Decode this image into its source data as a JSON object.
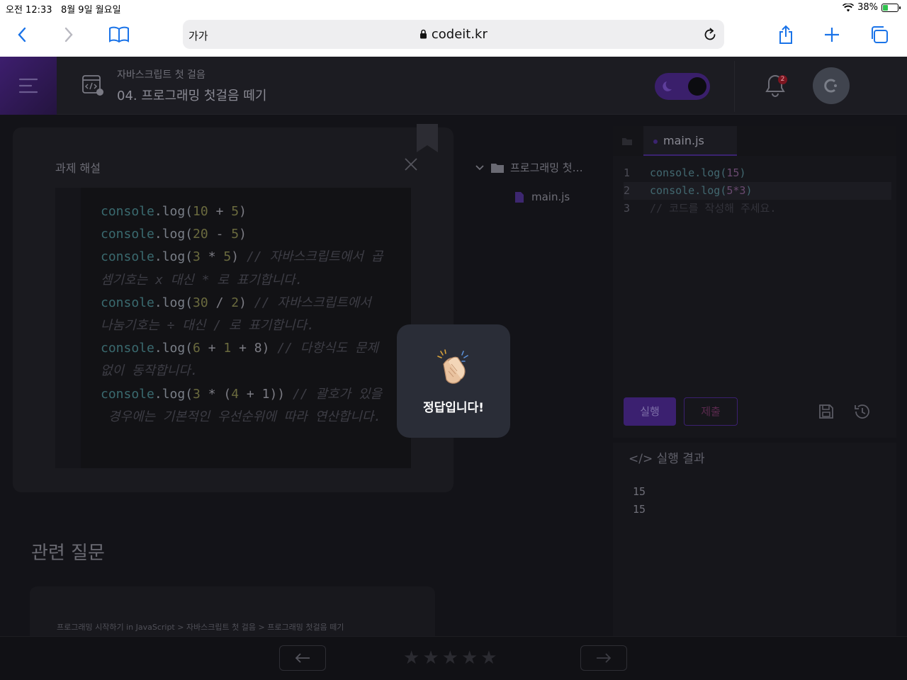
{
  "status": {
    "time": "오전 12:33",
    "date": "8월 9일 월요일",
    "battery": "38%",
    "battery_level": 0.38
  },
  "safari": {
    "text_size": "가가",
    "host": "codeit.kr"
  },
  "header": {
    "course_sub": "자바스크립트 첫 걸음",
    "course_title": "04. 프로그래밍 첫걸음 떼기",
    "notification_count": "2"
  },
  "panel": {
    "title": "과제 해설",
    "code": [
      {
        "fn": "console",
        "rest": ".log(",
        "n1": "10",
        "op": " + ",
        "n2": "5",
        "tail": ")",
        "comment": ""
      },
      {
        "fn": "console",
        "rest": ".log(",
        "n1": "20",
        "op": " - ",
        "n2": "5",
        "tail": ")",
        "comment": ""
      },
      {
        "fn": "console",
        "rest": ".log(",
        "n1": "3",
        "op": " * ",
        "n2": "5",
        "tail": ") ",
        "comment": "// 자바스크립트에서 곱"
      },
      {
        "fn": "",
        "rest": "",
        "n1": "",
        "op": "",
        "n2": "",
        "tail": "",
        "comment": "셈기호는 x 대신 * 로 표기합니다."
      },
      {
        "fn": "console",
        "rest": ".log(",
        "n1": "30",
        "op": " / ",
        "n2": "2",
        "tail": ") ",
        "comment": "// 자바스크립트에서"
      },
      {
        "fn": "",
        "rest": "",
        "n1": "",
        "op": "",
        "n2": "",
        "tail": "",
        "comment": "나눔기호는 ÷ 대신 / 로 표기합니다."
      },
      {
        "fn": "console",
        "rest": ".log(",
        "n1": "6",
        "op": " + ",
        "n2": "1",
        "tail": " + 8) ",
        "comment": "// 다항식도 문제"
      },
      {
        "fn": "",
        "rest": "",
        "n1": "",
        "op": "",
        "n2": "",
        "tail": "",
        "comment": "없이 동작합니다."
      },
      {
        "fn": "console",
        "rest": ".log(",
        "n1": "3",
        "op": " * (",
        "n2": "4",
        "tail": " + 1)) ",
        "comment": "// 괄호가 있을"
      },
      {
        "fn": "",
        "rest": "",
        "n1": "",
        "op": "",
        "n2": "",
        "tail": "",
        "comment": " 경우에는 기본적인 우선순위에 따라 연산합니다."
      }
    ]
  },
  "related": {
    "title": "관련 질문",
    "breadcrumb": "프로그래밍 시작하기 in JavaScript > 자바스크립트 첫 걸음 > 프로그래밍 첫걸음 떼기"
  },
  "tree": {
    "folder": "프로그래밍 첫…",
    "file": "main.js"
  },
  "editor": {
    "tab": "main.js",
    "lines": [
      {
        "n": "1",
        "fn": "console.log(",
        "num": "15",
        "end": ")",
        "cm": ""
      },
      {
        "n": "2",
        "fn": "console.log(",
        "num": "5*3",
        "end": ")",
        "cm": ""
      },
      {
        "n": "3",
        "fn": "",
        "num": "",
        "end": "",
        "cm": "// 코드를 작성해 주세요."
      }
    ],
    "run_label": "실행",
    "submit_label": "제출"
  },
  "result": {
    "title": "</> 실행 결과",
    "output": [
      "15",
      "15"
    ]
  },
  "footer": {
    "stars": [
      "★",
      "★",
      "★",
      "★",
      "★"
    ]
  },
  "toast": {
    "message": "정답입니다!",
    "emoji": "clapping-hands-icon"
  }
}
